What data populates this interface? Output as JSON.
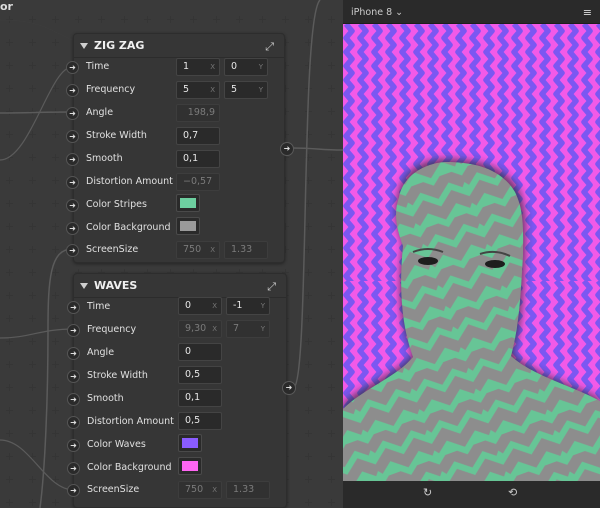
{
  "window": {
    "title_fragment": "or"
  },
  "icons": {
    "expand": "expand-icon",
    "port": "arrow-right-icon",
    "menu": "hamburger-menu-icon",
    "reset": "reset-icon",
    "rotate": "rotate-icon"
  },
  "viewer": {
    "device": "iPhone 8",
    "chevron": "⌄",
    "menu_glyph": "≡",
    "reset_glyph": "↻",
    "rotate_glyph": "⟲"
  },
  "zigzag": {
    "title": "ZIG ZAG",
    "rows": {
      "time": {
        "label": "Time",
        "x": "1",
        "y": "0"
      },
      "frequency": {
        "label": "Frequency",
        "x": "5",
        "y": "5"
      },
      "angle": {
        "label": "Angle",
        "value": "198,9"
      },
      "stroke_width": {
        "label": "Stroke Width",
        "value": "0,7"
      },
      "smooth": {
        "label": "Smooth",
        "value": "0,1"
      },
      "distortion": {
        "label": "Distortion Amount",
        "value": "−0,57"
      },
      "color_stripes": {
        "label": "Color Stripes",
        "color": "#6dcfa0"
      },
      "color_background": {
        "label": "Color Background",
        "color": "#9a9a9a"
      },
      "screen_size": {
        "label": "ScreenSize",
        "x": "750",
        "y": "1.33"
      }
    }
  },
  "waves": {
    "title": "WAVES",
    "rows": {
      "time": {
        "label": "Time",
        "x": "0",
        "y": "-1"
      },
      "frequency": {
        "label": "Frequency",
        "x": "9,30",
        "y": "7"
      },
      "angle": {
        "label": "Angle",
        "value": "0"
      },
      "stroke_width": {
        "label": "Stroke Width",
        "value": "0,5"
      },
      "smooth": {
        "label": "Smooth",
        "value": "0,1"
      },
      "distortion": {
        "label": "Distortion Amount",
        "value": "0,5"
      },
      "color_waves": {
        "label": "Color Waves",
        "color": "#8a5cff"
      },
      "color_background": {
        "label": "Color Background",
        "color": "#ff66f2"
      },
      "screen_size": {
        "label": "ScreenSize",
        "x": "750",
        "y": "1.33"
      }
    }
  },
  "axis": {
    "x": "X",
    "y": "Y"
  },
  "colors": {
    "wave_purple": "#7c57f2",
    "wave_pink": "#f25ae8",
    "zig_green": "#67c596",
    "zig_gray": "#8c8c8c"
  }
}
